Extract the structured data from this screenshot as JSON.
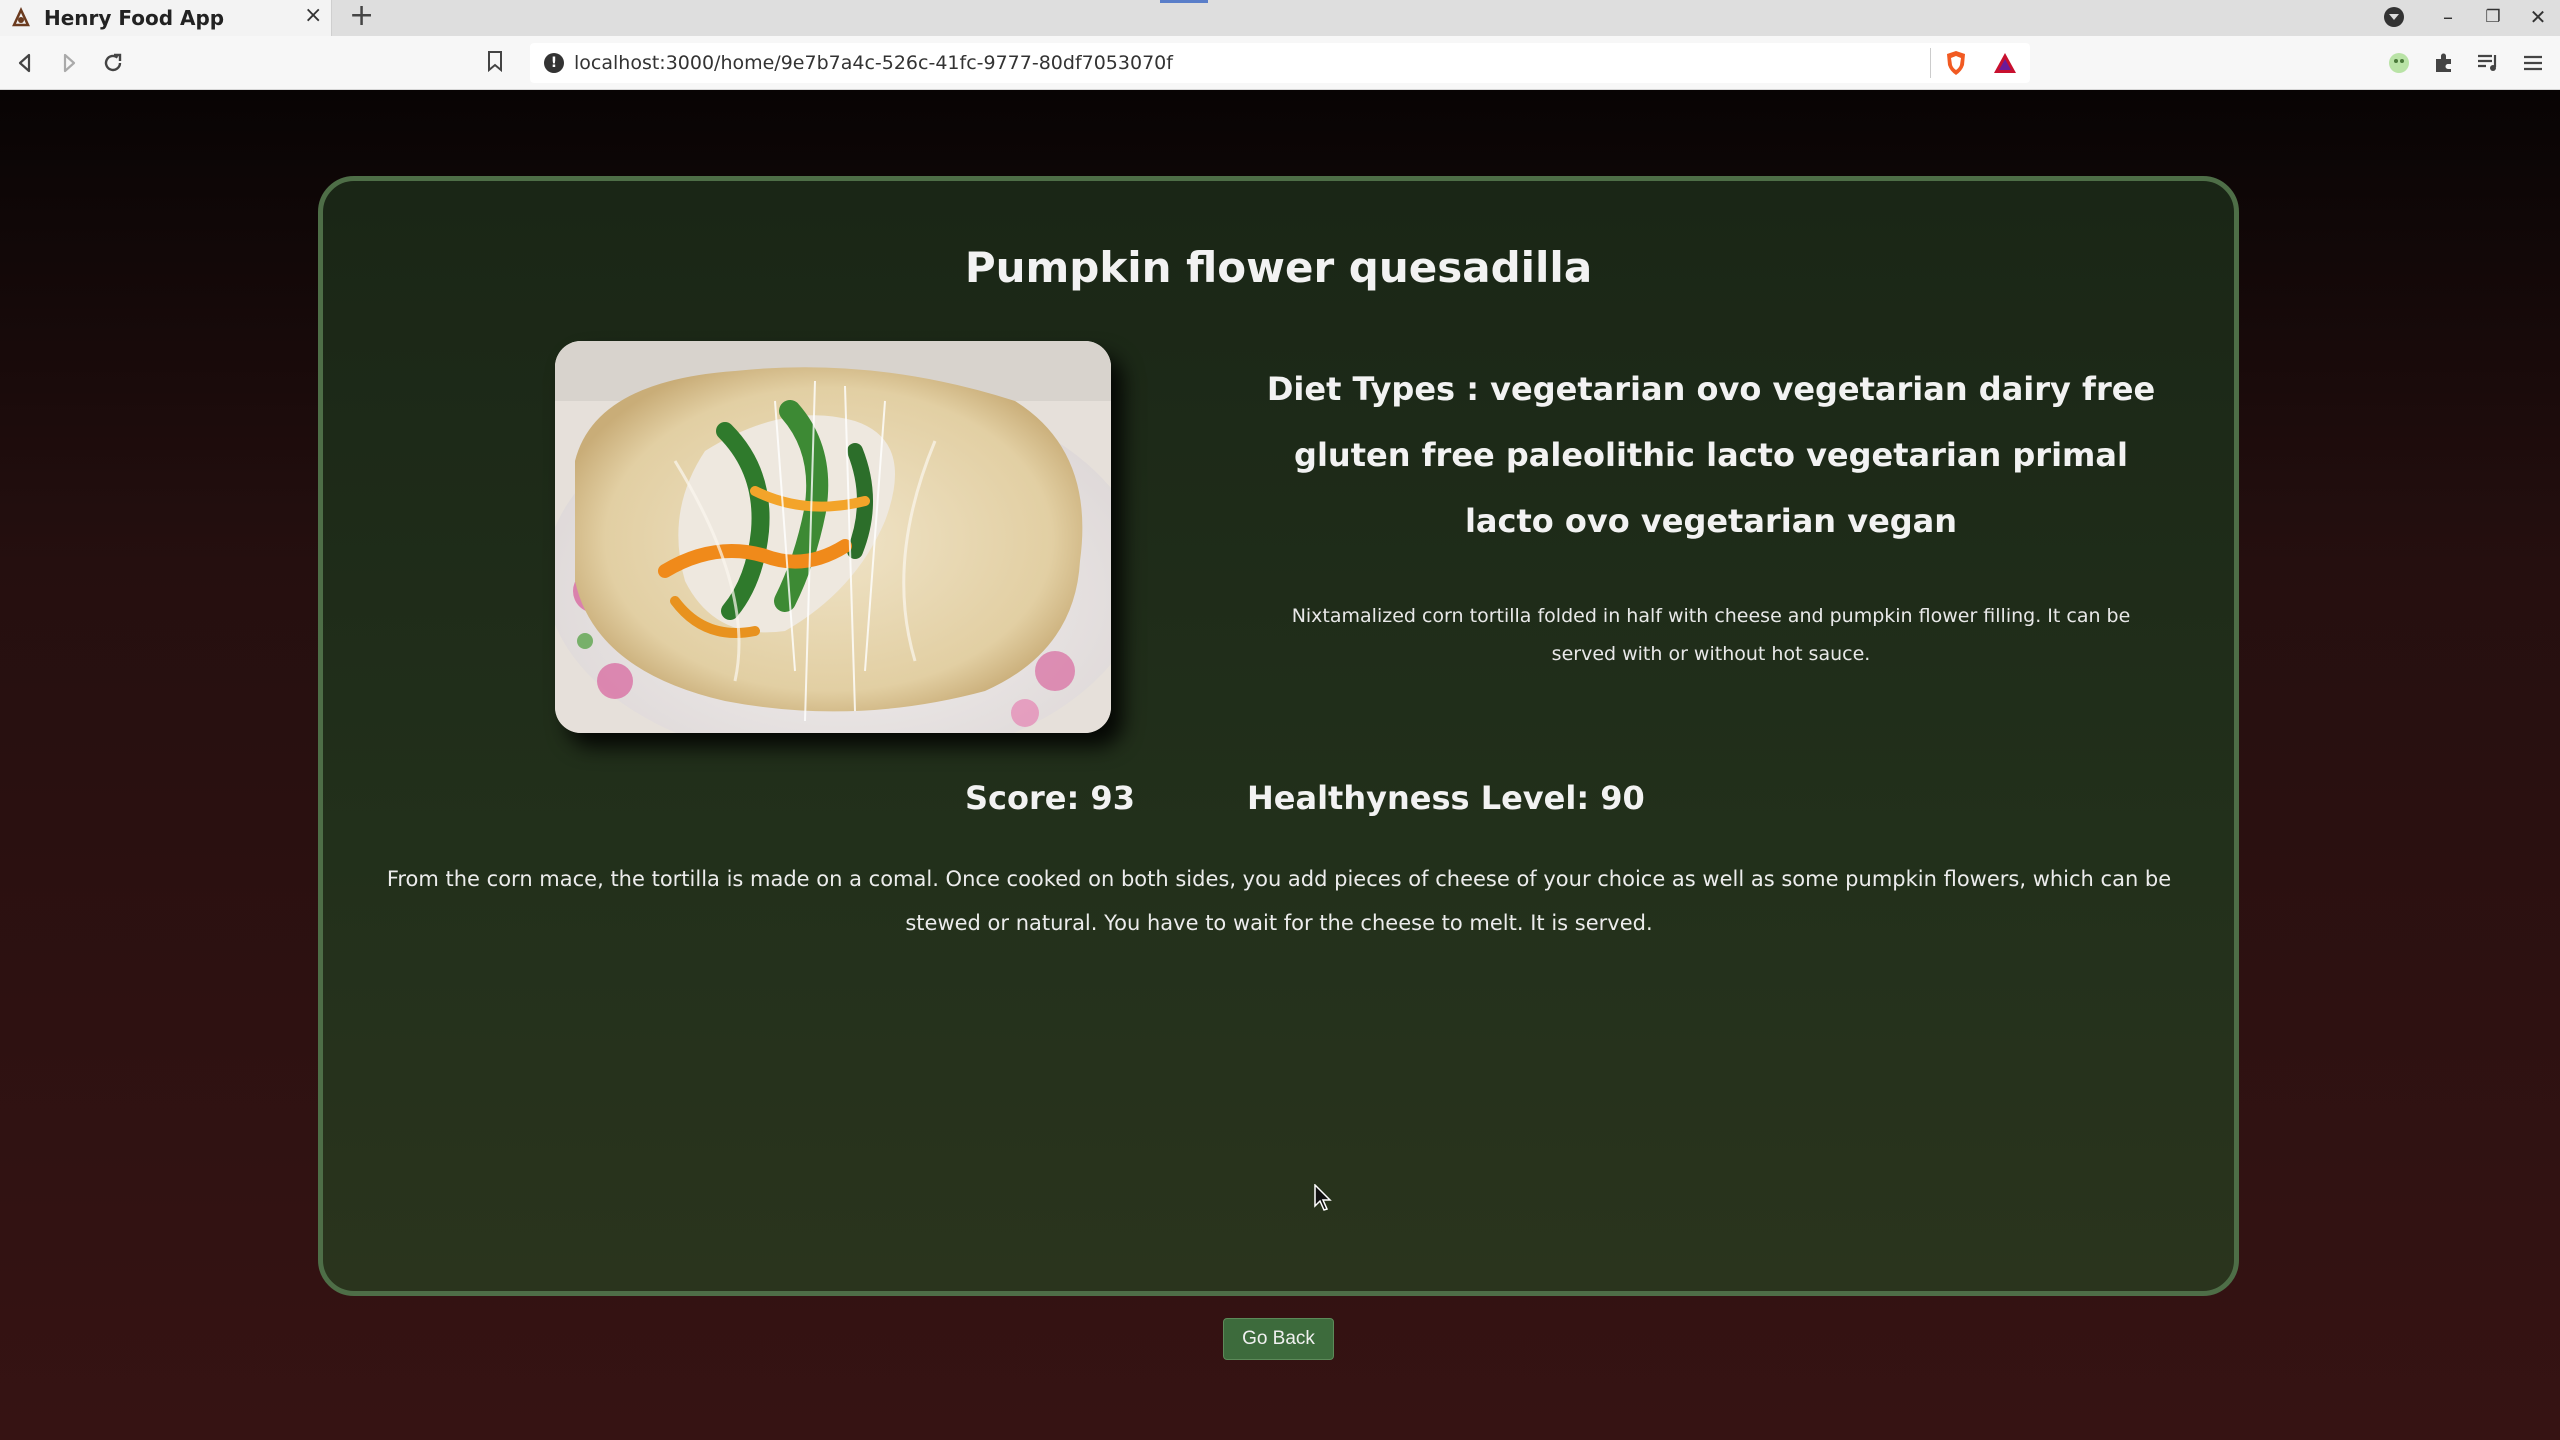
{
  "browser": {
    "tab_title": "Henry Food App",
    "tab_close": "×",
    "new_tab": "+",
    "url": "localhost:3000/home/9e7b7a4c-526c-41fc-9777-80df7053070f",
    "info_icon": "!",
    "window_controls": {
      "minimize": "–",
      "restore": "❐",
      "close": "✕"
    }
  },
  "recipe": {
    "title": "Pumpkin flower quesadilla",
    "diet_types": "Diet Types : vegetarian ovo vegetarian dairy free gluten free paleolithic lacto vegetarian primal lacto ovo vegetarian vegan",
    "summary": "Nixtamalized corn tortilla folded in half with cheese and pumpkin flower filling. It can be served with or without hot sauce.",
    "score": "Score: 93",
    "health_score": "Healthyness Level: 90",
    "steps": "From the corn mace, the tortilla is made on a comal. Once cooked on both sides, you add pieces of cheese of your choice as well as some pumpkin flowers, which can be stewed or natural. You have to wait for the cheese to melt. It is served."
  },
  "actions": {
    "go_back": "Go Back"
  },
  "colors": {
    "card_border": "#4e6e47",
    "card_bg": "#22301b",
    "button_bg": "#3d6b3c",
    "page_bg": "#250f0f"
  }
}
